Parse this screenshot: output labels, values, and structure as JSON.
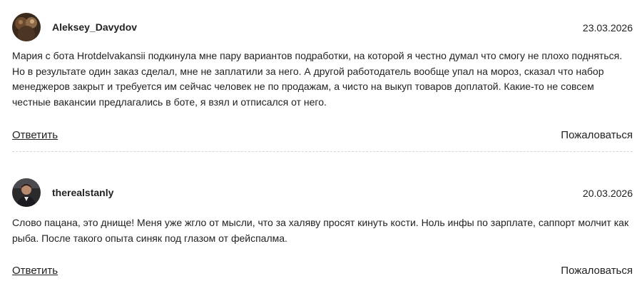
{
  "comments": [
    {
      "avatar_icon": "user-avatar-photo",
      "username": "Aleksey_Davydov",
      "date": "23.03.2026",
      "text": "Мария с бота Hrotdelvakansii подкинула мне пару вариантов подработки, на которой я честно думал что смогу не плохо подняться. Но в результате один заказ сделал, мне не заплатили за него. А другой работодатель вообще упал на мороз, сказал что набор менеджеров закрыт и требуется им сейчас человек не по продажам, а чисто на выкуп товаров доплатой. Какие-то не совсем честные вакансии предлагались в боте, я взял и отписался от него.",
      "reply_label": "Ответить",
      "report_label": "Пожаловаться"
    },
    {
      "avatar_icon": "user-avatar-photo",
      "username": "therealstanly",
      "date": "20.03.2026",
      "text": "Слово пацана, это днище! Меня уже жгло от мысли, что за халяву просят кинуть кости. Ноль инфы по зарплате, саппорт молчит как рыба. После такого опыта синяк под глазом от фейспалма.",
      "reply_label": "Ответить",
      "report_label": "Пожаловаться"
    }
  ]
}
